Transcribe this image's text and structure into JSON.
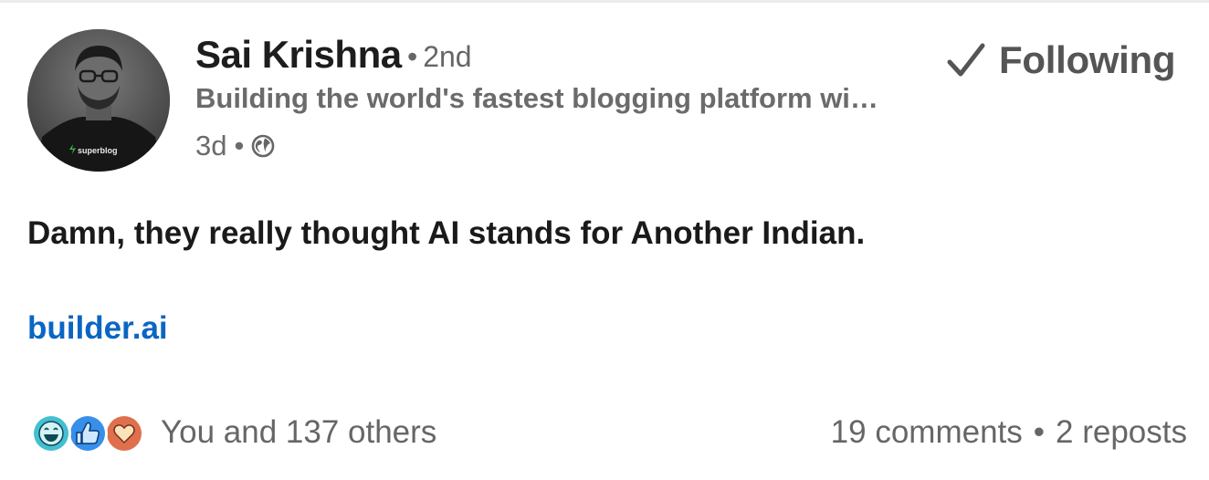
{
  "author": {
    "name": "Sai Krishna",
    "degree_sep": "•",
    "degree": "2nd",
    "headline": "Building the world's fastest blogging platform wi…",
    "avatar_shirt_text": "superblog"
  },
  "meta": {
    "time": "3d",
    "sep": "•",
    "visibility_icon": "globe-icon"
  },
  "follow": {
    "icon": "check-icon",
    "label": "Following"
  },
  "post": {
    "text": "Damn, they really thought AI stands for Another Indian.",
    "link": "builder.ai"
  },
  "social": {
    "reaction_icons": [
      "funny-reaction-icon",
      "like-reaction-icon",
      "love-reaction-icon"
    ],
    "reactions_summary": "You and 137 others",
    "comments": "19 comments",
    "sep": "•",
    "reposts": "2 reposts"
  },
  "colors": {
    "link": "#0a66c2",
    "funny": "#44bfd1",
    "like": "#378fe9",
    "love": "#df704d"
  }
}
